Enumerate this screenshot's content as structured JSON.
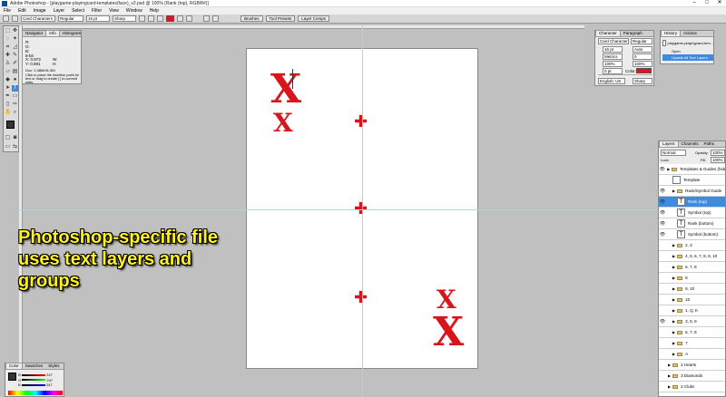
{
  "window": {
    "title": "Adobe Photoshop - [playgame-playingcard-templates(face)_v2.psd @ 100% (Rank (top), RGB/8#)]"
  },
  "menu": [
    "File",
    "Edit",
    "Image",
    "Layer",
    "Select",
    "Filter",
    "View",
    "Window",
    "Help"
  ],
  "options": {
    "font_family": "Card Characters",
    "font_style": "Regular",
    "font_size": "16 pt",
    "antialias": "Sharp",
    "tabs": [
      "Brushes",
      "Tool Presets",
      "Layer Comps"
    ]
  },
  "navigator_panel": {
    "tabs": [
      "Navigator",
      "Info",
      "Histogram"
    ],
    "info_lines": [
      "R:",
      "G:",
      "B:",
      "8-bit",
      "X:",
      "Y:",
      "W:",
      "H:"
    ],
    "values": [
      "0.873",
      "0.591"
    ],
    "doc": "Doc: 2.48M/41.5M",
    "hint": "Click to place the insertion point for text or drag to create [ ] to commit edits."
  },
  "character_panel": {
    "tabs": [
      "Character",
      "Paragraph"
    ],
    "font_family": "Card Characters",
    "font_style": "Regular",
    "size": "16 pt",
    "leading": "Auto",
    "kerning": "Metrics",
    "tracking": "0",
    "vscale": "100%",
    "hscale": "100%",
    "baseline": "0 pt",
    "color_label": "Color:",
    "language": "English: UK",
    "aa": "Sharp"
  },
  "history_panel": {
    "tabs": [
      "History",
      "Actions"
    ],
    "snapshot": "playgame-playingcard-tem...",
    "items": [
      "Open",
      "Update All Text Layers"
    ]
  },
  "layers_panel": {
    "tabs": [
      "Layers",
      "Channels",
      "Paths"
    ],
    "blend": "Normal",
    "opacity_label": "Opacity:",
    "opacity": "100%",
    "fill_label": "Fill:",
    "fill": "100%",
    "lock_label": "Lock:",
    "rows": [
      {
        "name": "Templates & Guides (hide...",
        "kind": "group",
        "eye": true,
        "indent": 0
      },
      {
        "name": "Template",
        "kind": "image",
        "eye": false,
        "indent": 1
      },
      {
        "name": "Rank/Symbol Guide",
        "kind": "group",
        "eye": true,
        "indent": 1
      },
      {
        "name": "Rank (top)",
        "kind": "text",
        "eye": true,
        "indent": 2,
        "selected": true
      },
      {
        "name": "Symbol (top)",
        "kind": "text",
        "eye": true,
        "indent": 2
      },
      {
        "name": "Rank (bottom)",
        "kind": "text",
        "eye": true,
        "indent": 2
      },
      {
        "name": "Symbol (bottom)",
        "kind": "text",
        "eye": true,
        "indent": 2
      },
      {
        "name": "2, 3",
        "kind": "group",
        "eye": false,
        "indent": 1
      },
      {
        "name": "4, 5, 6, 7, 8, 9, 10",
        "kind": "group",
        "eye": false,
        "indent": 1
      },
      {
        "name": "6, 7, 8",
        "kind": "group",
        "eye": false,
        "indent": 1
      },
      {
        "name": "8",
        "kind": "group",
        "eye": false,
        "indent": 1
      },
      {
        "name": "9, 10",
        "kind": "group",
        "eye": false,
        "indent": 1
      },
      {
        "name": "10",
        "kind": "group",
        "eye": false,
        "indent": 1
      },
      {
        "name": "1, Q, K",
        "kind": "group",
        "eye": false,
        "indent": 1
      },
      {
        "name": "3, 5, 9",
        "kind": "group",
        "eye": true,
        "indent": 1
      },
      {
        "name": "6, 7, 8",
        "kind": "group",
        "eye": false,
        "indent": 1
      },
      {
        "name": "7",
        "kind": "group",
        "eye": false,
        "indent": 1
      },
      {
        "name": "A",
        "kind": "group",
        "eye": false,
        "indent": 1
      },
      {
        "name": "2 Hearts",
        "kind": "group",
        "eye": false,
        "indent": 0
      },
      {
        "name": "3 Diamonds",
        "kind": "group",
        "eye": false,
        "indent": 0
      },
      {
        "name": "2 Clubs",
        "kind": "group",
        "eye": false,
        "indent": 0
      }
    ]
  },
  "color_panel": {
    "tabs": [
      "Color",
      "Swatches",
      "Styles"
    ],
    "channels": [
      {
        "label": "R",
        "value": "247"
      },
      {
        "label": "G",
        "value": "247"
      },
      {
        "label": "B",
        "value": "247"
      }
    ]
  },
  "canvas": {
    "rank_glyph": "X",
    "symbol_glyph": "X",
    "pip": "✚"
  },
  "caption": "Photoshop-specific file uses text layers and groups",
  "colors": {
    "accent_red": "#d8141d",
    "caption_yellow": "#fff21e",
    "selection_blue": "#3d8be0",
    "guide": "#7fe8f0"
  }
}
